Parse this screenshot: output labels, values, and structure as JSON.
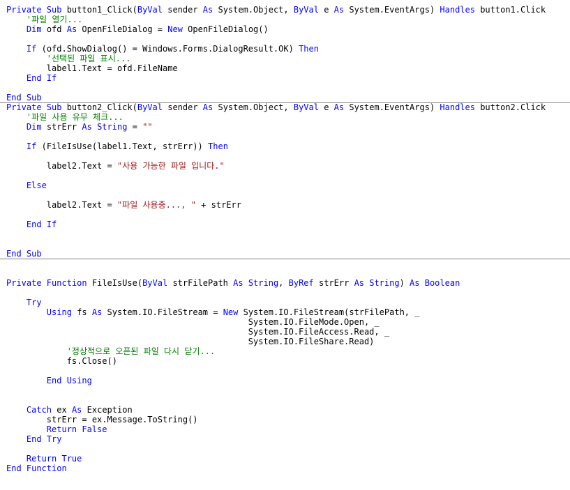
{
  "colors": {
    "keyword": "#0000ff",
    "comment": "#008000",
    "string": "#a31515",
    "plain": "#000000",
    "separator": "#808080"
  },
  "code_blocks": [
    {
      "name": "button1-click-sub",
      "lines": [
        [
          [
            "k",
            "Private Sub "
          ],
          [
            "p",
            "button1_Click("
          ],
          [
            "k",
            "ByVal "
          ],
          [
            "p",
            "sender "
          ],
          [
            "k",
            "As "
          ],
          [
            "p",
            "System.Object, "
          ],
          [
            "k",
            "ByVal "
          ],
          [
            "p",
            "e "
          ],
          [
            "k",
            "As "
          ],
          [
            "p",
            "System.EventArgs) "
          ],
          [
            "k",
            "Handles "
          ],
          [
            "p",
            "button1.Click"
          ]
        ],
        [
          [
            "p",
            "    "
          ],
          [
            "c",
            "'파일 열기..."
          ]
        ],
        [
          [
            "p",
            "    "
          ],
          [
            "k",
            "Dim "
          ],
          [
            "p",
            "ofd "
          ],
          [
            "k",
            "As "
          ],
          [
            "p",
            "OpenFileDialog = "
          ],
          [
            "k",
            "New "
          ],
          [
            "p",
            "OpenFileDialog()"
          ]
        ],
        [],
        [
          [
            "p",
            "    "
          ],
          [
            "k",
            "If "
          ],
          [
            "p",
            "(ofd.ShowDialog() = Windows.Forms.DialogResult.OK) "
          ],
          [
            "k",
            "Then"
          ]
        ],
        [
          [
            "p",
            "        "
          ],
          [
            "c",
            "'선택된 파일 표시..."
          ]
        ],
        [
          [
            "p",
            "        label1.Text = ofd.FileName"
          ]
        ],
        [
          [
            "p",
            "    "
          ],
          [
            "k",
            "End If"
          ]
        ],
        [],
        [
          [
            "k",
            "End Sub"
          ]
        ]
      ]
    },
    {
      "name": "button2-click-sub",
      "lines": [
        [
          [
            "k",
            "Private Sub "
          ],
          [
            "p",
            "button2_Click("
          ],
          [
            "k",
            "ByVal "
          ],
          [
            "p",
            "sender "
          ],
          [
            "k",
            "As "
          ],
          [
            "p",
            "System.Object, "
          ],
          [
            "k",
            "ByVal "
          ],
          [
            "p",
            "e "
          ],
          [
            "k",
            "As "
          ],
          [
            "p",
            "System.EventArgs) "
          ],
          [
            "k",
            "Handles "
          ],
          [
            "p",
            "button2.Click"
          ]
        ],
        [
          [
            "p",
            "    "
          ],
          [
            "c",
            "'파일 사용 유무 체크..."
          ]
        ],
        [
          [
            "p",
            "    "
          ],
          [
            "k",
            "Dim "
          ],
          [
            "p",
            "strErr "
          ],
          [
            "k",
            "As String "
          ],
          [
            "p",
            "= "
          ],
          [
            "s",
            "\"\""
          ]
        ],
        [],
        [
          [
            "p",
            "    "
          ],
          [
            "k",
            "If "
          ],
          [
            "p",
            "(FileIsUse(label1.Text, strErr)) "
          ],
          [
            "k",
            "Then"
          ]
        ],
        [],
        [
          [
            "p",
            "        label2.Text = "
          ],
          [
            "s",
            "\"사용 가능한 파일 입니다.\""
          ]
        ],
        [],
        [
          [
            "p",
            "    "
          ],
          [
            "k",
            "Else"
          ]
        ],
        [],
        [
          [
            "p",
            "        label2.Text = "
          ],
          [
            "s",
            "\"파일 사용중..., \""
          ],
          [
            "p",
            " + strErr"
          ]
        ],
        [],
        [
          [
            "p",
            "    "
          ],
          [
            "k",
            "End If"
          ]
        ],
        [],
        [],
        [
          [
            "k",
            "End Sub"
          ]
        ]
      ]
    },
    {
      "name": "fileisuse-function",
      "lines": [
        [],
        [],
        [
          [
            "k",
            "Private Function "
          ],
          [
            "p",
            "FileIsUse("
          ],
          [
            "k",
            "ByVal "
          ],
          [
            "p",
            "strFilePath "
          ],
          [
            "k",
            "As String"
          ],
          [
            "p",
            ", "
          ],
          [
            "k",
            "ByRef "
          ],
          [
            "p",
            "strErr "
          ],
          [
            "k",
            "As String"
          ],
          [
            "p",
            ") "
          ],
          [
            "k",
            "As Boolean"
          ]
        ],
        [],
        [
          [
            "p",
            "    "
          ],
          [
            "k",
            "Try"
          ]
        ],
        [
          [
            "p",
            "        "
          ],
          [
            "k",
            "Using "
          ],
          [
            "p",
            "fs "
          ],
          [
            "k",
            "As "
          ],
          [
            "p",
            "System.IO.FileStream = "
          ],
          [
            "k",
            "New "
          ],
          [
            "p",
            "System.IO.FileStream(strFilePath, _"
          ]
        ],
        [
          [
            "p",
            "                                                System.IO.FileMode.Open, _"
          ]
        ],
        [
          [
            "p",
            "                                                System.IO.FileAccess.Read, _"
          ]
        ],
        [
          [
            "p",
            "                                                System.IO.FileShare.Read)"
          ]
        ],
        [
          [
            "p",
            "            "
          ],
          [
            "c",
            "'정상적으로 오픈된 파일 다시 닫기..."
          ]
        ],
        [
          [
            "p",
            "            fs.Close()"
          ]
        ],
        [],
        [
          [
            "p",
            "        "
          ],
          [
            "k",
            "End Using"
          ]
        ],
        [],
        [],
        [
          [
            "p",
            "    "
          ],
          [
            "k",
            "Catch "
          ],
          [
            "p",
            "ex "
          ],
          [
            "k",
            "As "
          ],
          [
            "p",
            "Exception"
          ]
        ],
        [
          [
            "p",
            "        strErr = ex.Message.ToString()"
          ]
        ],
        [
          [
            "p",
            "        "
          ],
          [
            "k",
            "Return False"
          ]
        ],
        [
          [
            "p",
            "    "
          ],
          [
            "k",
            "End Try"
          ]
        ],
        [],
        [
          [
            "p",
            "    "
          ],
          [
            "k",
            "Return True"
          ]
        ],
        [
          [
            "k",
            "End Function"
          ]
        ]
      ]
    }
  ]
}
